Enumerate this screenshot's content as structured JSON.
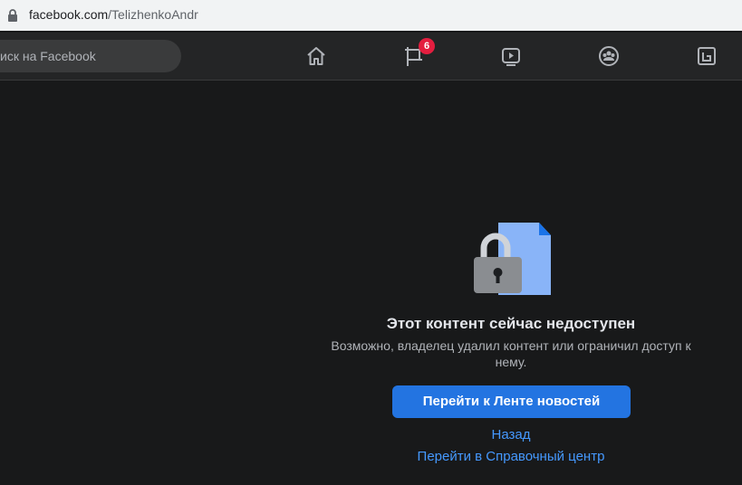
{
  "browser": {
    "url_domain": "facebook.com",
    "url_path": "/TelizhenkoAndr"
  },
  "nav": {
    "search_placeholder": "иск на Facebook",
    "notifications_count": "6",
    "icons": [
      "home-icon",
      "pages-flag-icon",
      "watch-video-icon",
      "groups-icon",
      "gaming-icon"
    ]
  },
  "main": {
    "title": "Этот контент сейчас недоступен",
    "description": "Возможно, владелец удалил контент или ограничил доступ к нему.",
    "primary_button": "Перейти к Ленте новостей",
    "back_link": "Назад",
    "help_link": "Перейти в Справочный центр"
  },
  "colors": {
    "background": "#18191a",
    "nav": "#242526",
    "accent": "#2374e1",
    "link": "#4599ff",
    "badge": "#e41e3f"
  }
}
